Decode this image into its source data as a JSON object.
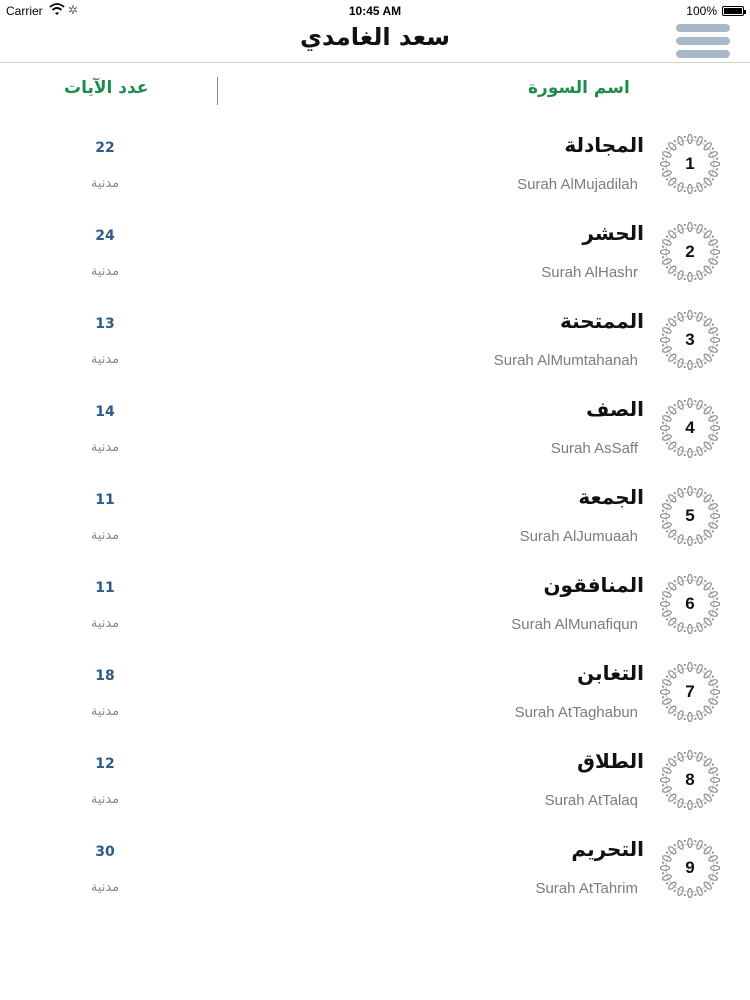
{
  "status_bar": {
    "carrier": "Carrier",
    "time": "10:45 AM",
    "battery_text": "100%",
    "battery_level": 1.0,
    "wifi_icon": "wifi-icon",
    "activity_icon": "activity-spinner-icon"
  },
  "nav": {
    "title": "سعد الغامدي",
    "menu_icon": "hamburger-menu-icon",
    "menu_color": "#a9b8c9"
  },
  "header": {
    "ayat_label": "عدد الآيات",
    "sura_name_label": "اسم السورة",
    "accent_color": "#1e8c4b"
  },
  "suras": [
    {
      "number": "1",
      "name_ar": "المجادلة",
      "name_en": "Surah AlMujadilah",
      "ayat": "22",
      "type": "مدنية"
    },
    {
      "number": "2",
      "name_ar": "الحشر",
      "name_en": "Surah AlHashr",
      "ayat": "24",
      "type": "مدنية"
    },
    {
      "number": "3",
      "name_ar": "الممتحنة",
      "name_en": "Surah AlMumtahanah",
      "ayat": "13",
      "type": "مدنية"
    },
    {
      "number": "4",
      "name_ar": "الصف",
      "name_en": "Surah AsSaff",
      "ayat": "14",
      "type": "مدنية"
    },
    {
      "number": "5",
      "name_ar": "الجمعة",
      "name_en": "Surah AlJumuaah",
      "ayat": "11",
      "type": "مدنية"
    },
    {
      "number": "6",
      "name_ar": "المنافقون",
      "name_en": "Surah AlMunafiqun",
      "ayat": "11",
      "type": "مدنية"
    },
    {
      "number": "7",
      "name_ar": "التغابن",
      "name_en": "Surah AtTaghabun",
      "ayat": "18",
      "type": "مدنية"
    },
    {
      "number": "8",
      "name_ar": "الطلاق",
      "name_en": "Surah AtTalaq",
      "ayat": "12",
      "type": "مدنية"
    },
    {
      "number": "9",
      "name_ar": "التحريم",
      "name_en": "Surah AtTahrim",
      "ayat": "30",
      "type": "مدنية"
    }
  ]
}
